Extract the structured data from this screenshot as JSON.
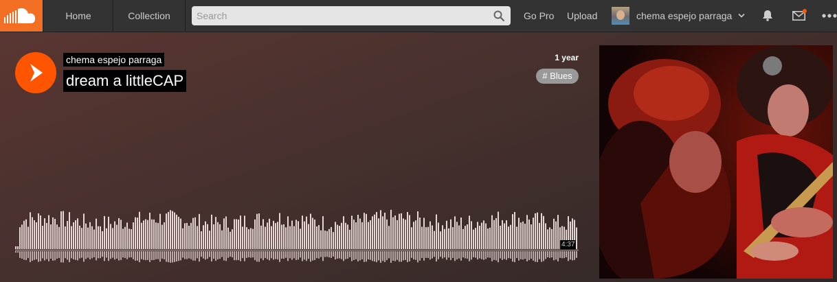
{
  "header": {
    "nav": {
      "home": "Home",
      "collection": "Collection"
    },
    "search": {
      "placeholder": "Search",
      "value": ""
    },
    "links": {
      "go_pro": "Go Pro",
      "upload": "Upload"
    },
    "user": {
      "name": "chema espejo parraga"
    },
    "icons": [
      "soundcloud-logo-icon",
      "search-icon",
      "chevron-down-icon",
      "bell-icon",
      "mail-icon",
      "more-icon"
    ],
    "colors": {
      "brand": "#f26f23",
      "notification_dot": "#ff5500"
    }
  },
  "track": {
    "artist": "chema espejo parraga",
    "title": "dream a littleCAP",
    "posted": "1 year",
    "tag": "# Blues",
    "duration": "4:37",
    "colors": {
      "play_button": "#ff5500",
      "waveform": "#e6d6d4"
    }
  }
}
